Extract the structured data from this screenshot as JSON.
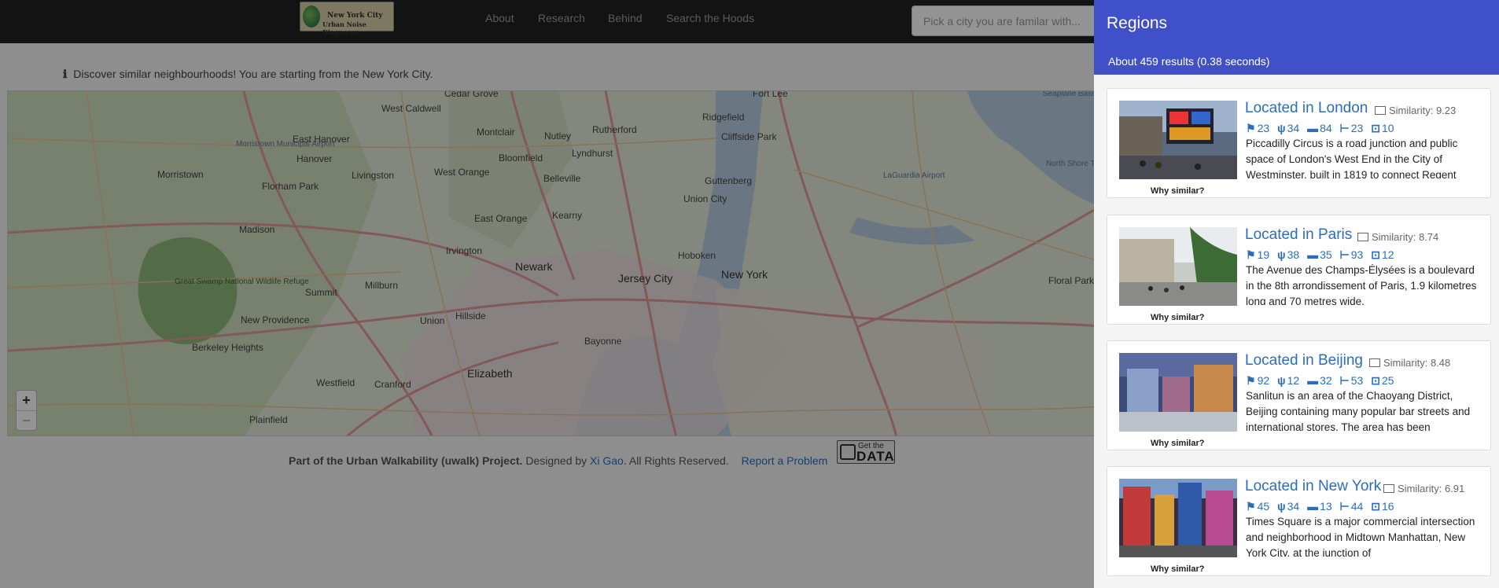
{
  "navbar": {
    "logo": {
      "line1": "New York City",
      "line2": "Urban Noise Diagnoser"
    },
    "links": [
      "About",
      "Research",
      "Behind",
      "Search the Hoods"
    ],
    "search_placeholder": "Pick a city you are familar with..."
  },
  "info": {
    "icon": "ℹ",
    "text": "Discover similar neighbourhoods! You are starting from the New York City."
  },
  "map": {
    "labels": [
      "Cedar Grove",
      "West Caldwell",
      "Montclair",
      "Nutley",
      "Rutherford",
      "Ridgefield",
      "Fort Lee",
      "Cliffside Park",
      "East Hanover",
      "Morristown",
      "Hanover",
      "Livingston",
      "West Orange",
      "Bloomfield",
      "Belleville",
      "Lyndhurst",
      "Guttenberg",
      "Union City",
      "Morristown Municipal Airport",
      "Florham Park",
      "Madison",
      "East Orange",
      "Kearny",
      "Hoboken",
      "Irvington",
      "Newark",
      "Jersey City",
      "New York",
      "Summit",
      "Millburn",
      "Great Swamp National Wildlife Refuge",
      "New Providence",
      "Union",
      "Hillside",
      "Berkeley Heights",
      "Elizabeth",
      "Bayonne",
      "Westfield",
      "Cranford",
      "Plainfield",
      "LaGuardia Airport",
      "Seaplane Base",
      "North Shore Towers Heliport",
      "Floral Park"
    ],
    "zoom_in": "+",
    "zoom_out": "−"
  },
  "footer": {
    "project": "Part of the Urban Walkability (uwalk) Project.",
    "designed_by": "Designed by",
    "author": "Xi Gao",
    "rights": ". All Rights Reserved.",
    "report": "Report a Problem",
    "badge_top": "Get the",
    "badge_main": "DATA"
  },
  "panel": {
    "title": "Regions",
    "results": "About 459 results (0.38 seconds)",
    "cards": [
      {
        "title": "Located in London",
        "similarity": "Similarity: 9.23",
        "stats": [
          "23",
          "34",
          "84",
          "23",
          "10"
        ],
        "description": "Piccadilly Circus is a road junction and public space of London's West End in the City of Westminster, built in 1819 to connect Regent",
        "why": "Why similar?"
      },
      {
        "title": "Located in Paris",
        "similarity": "Similarity: 8.74",
        "stats": [
          "19",
          "38",
          "35",
          "93",
          "12"
        ],
        "description": "The Avenue des Champs-Élysées is a boulevard in the 8th arrondissement of Paris, 1.9 kilometres long and 70 metres wide,",
        "why": "Why similar?"
      },
      {
        "title": "Located in Beijing",
        "similarity": "Similarity: 8.48",
        "stats": [
          "92",
          "12",
          "32",
          "53",
          "25"
        ],
        "description": "Sanlitun is an area of the Chaoyang District, Beijing containing many popular bar streets and international stores. The area has been",
        "why": "Why similar?"
      },
      {
        "title": "Located in New York",
        "similarity": "Similarity: 6.91",
        "stats": [
          "45",
          "34",
          "13",
          "44",
          "16"
        ],
        "description": "Times Square is a major commercial intersection and neighborhood in Midtown Manhattan, New York City, at the junction of",
        "why": "Why similar?"
      }
    ]
  }
}
